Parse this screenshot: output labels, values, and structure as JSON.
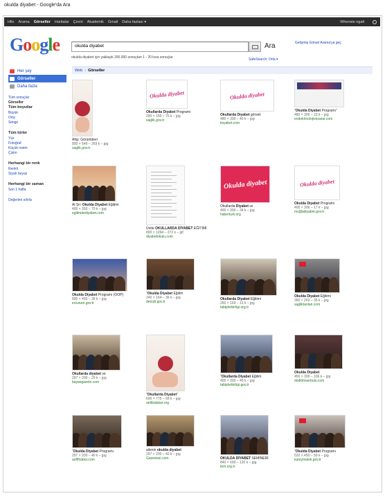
{
  "window": {
    "title": "okulda diyabet - Google'da Ara"
  },
  "topnav": {
    "links": [
      "Hllo",
      "Arama",
      "Görseller",
      "Haritalar",
      "Çeviri",
      "Akademik",
      "Gmail",
      "Daha fazlası ▾"
    ],
    "active_index": 2,
    "account": "Whenste ngall"
  },
  "logo": {
    "letters": [
      "G",
      "o",
      "o",
      "g",
      "l",
      "e"
    ]
  },
  "search": {
    "query": "okulda diyabet",
    "button_label": "Ara",
    "advanced_link": "Gelişmiş Görsel Arama'ya geç",
    "stats": "okulda diyabet için yaklaşık 200.000 sonuçtan 1 - 20 kısa sonuçlar",
    "safesearch": "SafeSearch: Orta ▾"
  },
  "breadcrumb": {
    "home": "Web",
    "separator": "›",
    "current": "Görseller"
  },
  "sidebar": {
    "items": [
      {
        "label": "Her şey",
        "icon": "everything-icon",
        "color": "#e8453c"
      },
      {
        "label": "Görseller",
        "icon": "images-icon",
        "color": "#ffffff"
      },
      {
        "label": "Daha fazla",
        "icon": "more-icon",
        "color": "#9aa0a6"
      }
    ],
    "active_index": 1,
    "sections": [
      {
        "heading": "Tüm boyutlar",
        "pre": [
          "Tüm sonuçlar",
          "Görseller"
        ],
        "links": [
          "Büyük",
          "Orta",
          "Simge"
        ]
      },
      {
        "heading": "Tüm türler",
        "links": [
          "Yüz",
          "Fotoğraf",
          "Küçük resim",
          "Çizim"
        ]
      },
      {
        "heading": "Herhangi bir renk",
        "links": [
          "Renkli",
          "Siyah beyaz"
        ]
      },
      {
        "heading": "Herhangi bir zaman",
        "links": [
          "Son 1 hafta"
        ]
      }
    ],
    "footer_link": "Değerleri sıfırla"
  },
  "results": [
    {
      "type": "poster",
      "caption_pre": "Afişi: ",
      "caption_bold": "",
      "caption_post": "Görüntüleri",
      "meta": "800 × 649 – 269 k – jpg",
      "domain": "saglik.gov.tr"
    },
    {
      "type": "logo",
      "logo_text": "Okulda diyabet",
      "caption_pre": "",
      "caption_bold": "Okullarda Diyabet",
      "caption_post": " Programı",
      "meta": "290 × 150 – 75 k – jpg",
      "domain": "saglik.gov.tr"
    },
    {
      "type": "logo",
      "logo_text": "Okulda diyabet",
      "caption_pre": "",
      "caption_bold": "Okullarda Diyabet",
      "caption_post": " görseli",
      "meta": "480 × 300 – 40 k – jpg",
      "domain": "tisyabet.com"
    },
    {
      "type": "banner",
      "caption_pre": "“",
      "caption_bold": "Okulda Diyabet",
      "caption_post": " Programı”",
      "meta": "480 × 300 – 23 k – jpg",
      "domain": "endokrinolojivezarar.com"
    },
    {
      "type": "photo_kids",
      "caption_pre": "Al Sn: ",
      "caption_bold": "Okulda Diyabet",
      "caption_post": " Eğitimi",
      "meta": "400 × 350 – 70 k – jpg",
      "domain": "egitimdediyabet.com"
    },
    {
      "type": "doc",
      "caption_pre": "Ünite ",
      "caption_bold": "OKULLARDA DİYABET",
      "caption_post": " EĞİTİMİ",
      "meta": "800 × 1094 – 272 k – gif",
      "domain": "diyabetokulu.com"
    },
    {
      "type": "redlogo",
      "logo_text": "Okulda diyabet",
      "caption_pre": "Okullarda ",
      "caption_bold": "Diyabet",
      "caption_post": " ve",
      "meta": "400 × 300 – 34 k – jpg",
      "domain": "haberturk.org"
    },
    {
      "type": "logo",
      "logo_text": "Okulda diyabet",
      "caption_pre": "",
      "caption_bold": "Okulda Diyabet",
      "caption_post": " Programı",
      "meta": "400 × 300 – 17 k – jpg",
      "domain": "muğladiyabet.gov.tr"
    },
    {
      "type": "photo_class",
      "caption_pre": "",
      "caption_bold": "Okulda Diyabet",
      "caption_post": " Programı (OOP)",
      "meta": "800 × 493 – 36 k – jpg",
      "domain": "erzurum.gov.tr"
    },
    {
      "type": "photo_meeting",
      "caption_pre": "“",
      "caption_bold": "Okulda Diyabet",
      "caption_post": " Eğitim",
      "meta": "240 × 164 – 36 k – jpg",
      "domain": "denizli.gov.tr"
    },
    {
      "type": "photo_room",
      "caption_pre": "",
      "caption_bold": "Okullarda Diyabet",
      "caption_post": " Eğitimi",
      "meta": "260 × 169 – 13 k – jpg",
      "domain": "tabiplerbirligi.org.tr"
    },
    {
      "type": "photo_flag",
      "caption_pre": "",
      "caption_bold": "Okulda Diyabet",
      "caption_post": " Eğitimi",
      "meta": "360 × 263 – 35 k – jpg",
      "domain": "sagliktanlari.com"
    },
    {
      "type": "photo_audience",
      "caption_pre": "",
      "caption_bold": "Okullarda diyabet",
      "caption_post": " ve",
      "meta": "297 × 200 – 20 k – jpg",
      "domain": "bayasgazete.com"
    },
    {
      "type": "poster",
      "caption_pre": "“",
      "caption_bold": "Okullarda Diyabet",
      "caption_post": "”",
      "meta": "600 × 775 – 69 k – jpg",
      "domain": "antibalatan.org"
    },
    {
      "type": "photo_hall",
      "caption_pre": "“",
      "caption_bold": "Okullarda Diyabet",
      "caption_post": " Eğitim",
      "meta": "400 × 300 – 40 k – jpg",
      "domain": "tabiplerbirligi.gov.tr"
    },
    {
      "type": "photo_crowd",
      "caption_pre": "",
      "caption_bold": "Okulda Diyabet",
      "caption_post": "",
      "meta": "450 × 300 – 106 k – jpg",
      "domain": "dodkimserbulu.com"
    },
    {
      "type": "photo_seminar",
      "caption_pre": "“",
      "caption_bold": "Okulda Diyabet",
      "caption_post": " Programı",
      "meta": "297 × 200 – 40 k – jpg",
      "domain": "aofifriabor.com"
    },
    {
      "type": "photo_table",
      "caption_pre": "ailenin ",
      "caption_bold": "okulda diyabet",
      "caption_post": "",
      "meta": "297 × 200 – 40 k – jpg",
      "domain": "Gazetean.com"
    },
    {
      "type": "photo_stage",
      "caption_pre": "",
      "caption_bold": "OKULDA DİYABET",
      "caption_post": " SEMİNERİ",
      "meta": "840 × 690 – 120 k – jpg",
      "domain": "tem.org.tr"
    },
    {
      "type": "photo_flag2",
      "caption_pre": "“",
      "caption_bold": "Okulda Diyabet",
      "caption_post": " Programı",
      "meta": "520 × 450 – 59 k – jpg",
      "domain": "kutuymalok.gov.tr"
    }
  ]
}
